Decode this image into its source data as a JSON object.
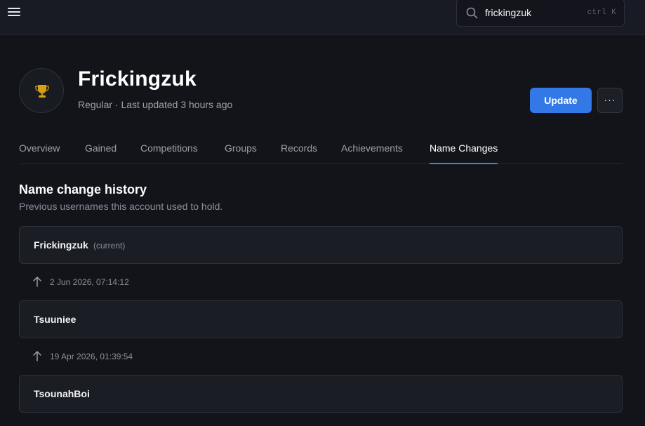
{
  "header": {
    "menu_icon": "hamburger-menu-icon",
    "search": {
      "icon": "search-icon",
      "value": "frickingzuk",
      "shortcut": "ctrl K"
    }
  },
  "player": {
    "avatar_icon": "trophy-icon",
    "name": "Frickingzuk",
    "meta": "Regular · Last updated 3 hours ago",
    "update_label": "Update",
    "more_label": "···"
  },
  "tabs": [
    {
      "label": "Overview"
    },
    {
      "label": "Gained"
    },
    {
      "label": "Competitions"
    },
    {
      "label": "Groups"
    },
    {
      "label": "Records"
    },
    {
      "label": "Achievements"
    },
    {
      "label": "Name Changes",
      "active": true
    }
  ],
  "name_history": {
    "title": "Name change history",
    "subtitle": "Previous usernames this account used to hold.",
    "entries": [
      {
        "name": "Frickingzuk",
        "tag": "(current)"
      },
      {
        "changed_at": "2 Jun 2026, 07:14:12",
        "icon": "arrow-up-icon"
      },
      {
        "name": "Tsuuniee"
      },
      {
        "changed_at": "19 Apr 2026, 01:39:54",
        "icon": "arrow-up-icon"
      },
      {
        "name": "TsounahBoi"
      }
    ]
  },
  "colors": {
    "background": "#13141a",
    "topbar": "#191b24",
    "card": "#1b1d25",
    "accent": "#3278e6",
    "tab_underline": "#3b82f6",
    "trophy": "#d4a017"
  }
}
